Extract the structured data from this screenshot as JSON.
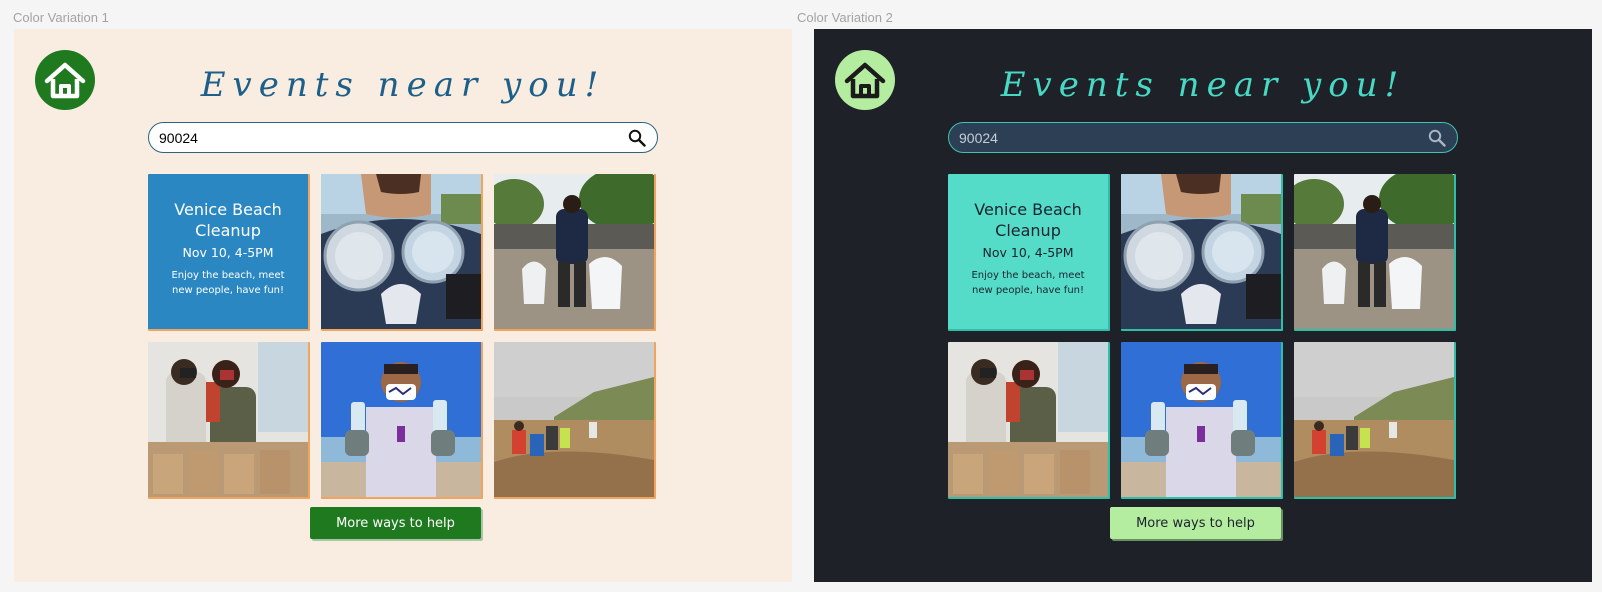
{
  "variations": [
    {
      "label": "Color Variation 1",
      "title": "Events near you!",
      "search_value": "90024",
      "event": {
        "name": "Venice Beach Cleanup",
        "date": "Nov 10, 4-5PM",
        "description": "Enjoy the beach, meet new people, have fun!"
      },
      "photos": [
        "volunteer-holding-plastic-lids",
        "volunteer-with-trash-bags",
        "volunteers-packing-bags",
        "volunteer-holding-bottles",
        "beach-cleanup-crew"
      ],
      "cta_label": "More ways to help",
      "colors": {
        "background": "#f8ede0",
        "accent": "#1f7a1f",
        "card": "#2a87c1",
        "tile_border": "#f0a45e",
        "title": "#1e5f8a"
      }
    },
    {
      "label": "Color Variation 2",
      "title": "Events near you!",
      "search_value": "90024",
      "event": {
        "name": "Venice Beach Cleanup",
        "date": "Nov 10, 4-5PM",
        "description": "Enjoy the beach, meet new people, have fun!"
      },
      "photos": [
        "volunteer-holding-plastic-lids",
        "volunteer-with-trash-bags",
        "volunteers-packing-bags",
        "volunteer-holding-bottles",
        "beach-cleanup-crew"
      ],
      "cta_label": "More ways to help",
      "colors": {
        "background": "#1e2128",
        "accent": "#b5eda0",
        "card": "#55dcc8",
        "tile_border": "#2fbfa9",
        "title": "#47d9c4"
      }
    }
  ]
}
